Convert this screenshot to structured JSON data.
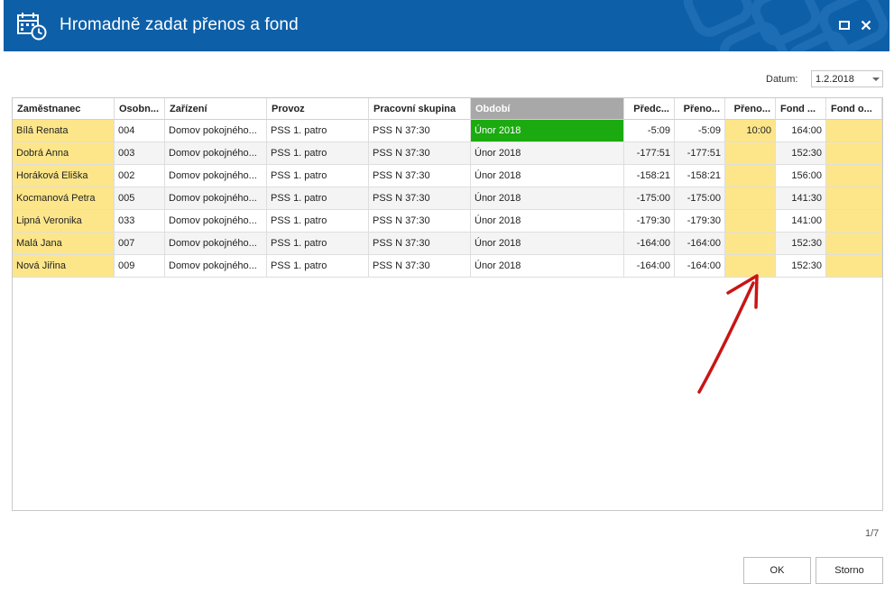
{
  "window": {
    "title": "Hromadně zadat přenos a fond",
    "icon": "calendar-clock-icon",
    "maximize_icon": "maximize-icon",
    "close_icon": "close-icon"
  },
  "date": {
    "label": "Datum:",
    "value": "1.2.2018"
  },
  "table": {
    "columns": [
      "Zaměstnanec",
      "Osobn...",
      "Zařízení",
      "Provoz",
      "Pracovní skupina",
      "Období",
      "Předc...",
      "Přeno...",
      "Přeno...",
      "Fond ...",
      "Fond o..."
    ],
    "rows": [
      {
        "name": "Bílá Renata",
        "osobni": "004",
        "zarizeni": "Domov pokojného...",
        "provoz": "PSS 1. patro",
        "skupina": "PSS N 37:30",
        "obdobi": "Únor 2018",
        "predchozi": "-5:09",
        "preneseno": "-5:09",
        "prenos": "10:00",
        "fond": "164:00",
        "fond_o": ""
      },
      {
        "name": "Dobrá Anna",
        "osobni": "003",
        "zarizeni": "Domov pokojného...",
        "provoz": "PSS 1. patro",
        "skupina": "PSS N 37:30",
        "obdobi": "Únor 2018",
        "predchozi": "-177:51",
        "preneseno": "-177:51",
        "prenos": "",
        "fond": "152:30",
        "fond_o": ""
      },
      {
        "name": "Horáková Eliška",
        "osobni": "002",
        "zarizeni": "Domov pokojného...",
        "provoz": "PSS 1. patro",
        "skupina": "PSS N 37:30",
        "obdobi": "Únor 2018",
        "predchozi": "-158:21",
        "preneseno": "-158:21",
        "prenos": "",
        "fond": "156:00",
        "fond_o": ""
      },
      {
        "name": "Kocmanová Petra",
        "osobni": "005",
        "zarizeni": "Domov pokojného...",
        "provoz": "PSS 1. patro",
        "skupina": "PSS N 37:30",
        "obdobi": "Únor 2018",
        "predchozi": "-175:00",
        "preneseno": "-175:00",
        "prenos": "",
        "fond": "141:30",
        "fond_o": ""
      },
      {
        "name": "Lipná Veronika",
        "osobni": "033",
        "zarizeni": "Domov pokojného...",
        "provoz": "PSS 1. patro",
        "skupina": "PSS N 37:30",
        "obdobi": "Únor 2018",
        "predchozi": "-179:30",
        "preneseno": "-179:30",
        "prenos": "",
        "fond": "141:00",
        "fond_o": ""
      },
      {
        "name": "Malá Jana",
        "osobni": "007",
        "zarizeni": "Domov pokojného...",
        "provoz": "PSS 1. patro",
        "skupina": "PSS N 37:30",
        "obdobi": "Únor 2018",
        "predchozi": "-164:00",
        "preneseno": "-164:00",
        "prenos": "",
        "fond": "152:30",
        "fond_o": ""
      },
      {
        "name": "Nová Jiřina",
        "osobni": "009",
        "zarizeni": "Domov pokojného...",
        "provoz": "PSS 1. patro",
        "skupina": "PSS N 37:30",
        "obdobi": "Únor 2018",
        "predchozi": "-164:00",
        "preneseno": "-164:00",
        "prenos": "",
        "fond": "152:30",
        "fond_o": ""
      }
    ]
  },
  "pager": "1/7",
  "buttons": {
    "ok": "OK",
    "storno": "Storno"
  },
  "colors": {
    "titlebar": "#0d5fa8",
    "editable_cell": "#fde68a",
    "active_period": "#1bab10",
    "selected_header": "#a8a8a8",
    "annotation_arrow": "#d11a1a"
  },
  "annotation": "red-arrow-icon"
}
